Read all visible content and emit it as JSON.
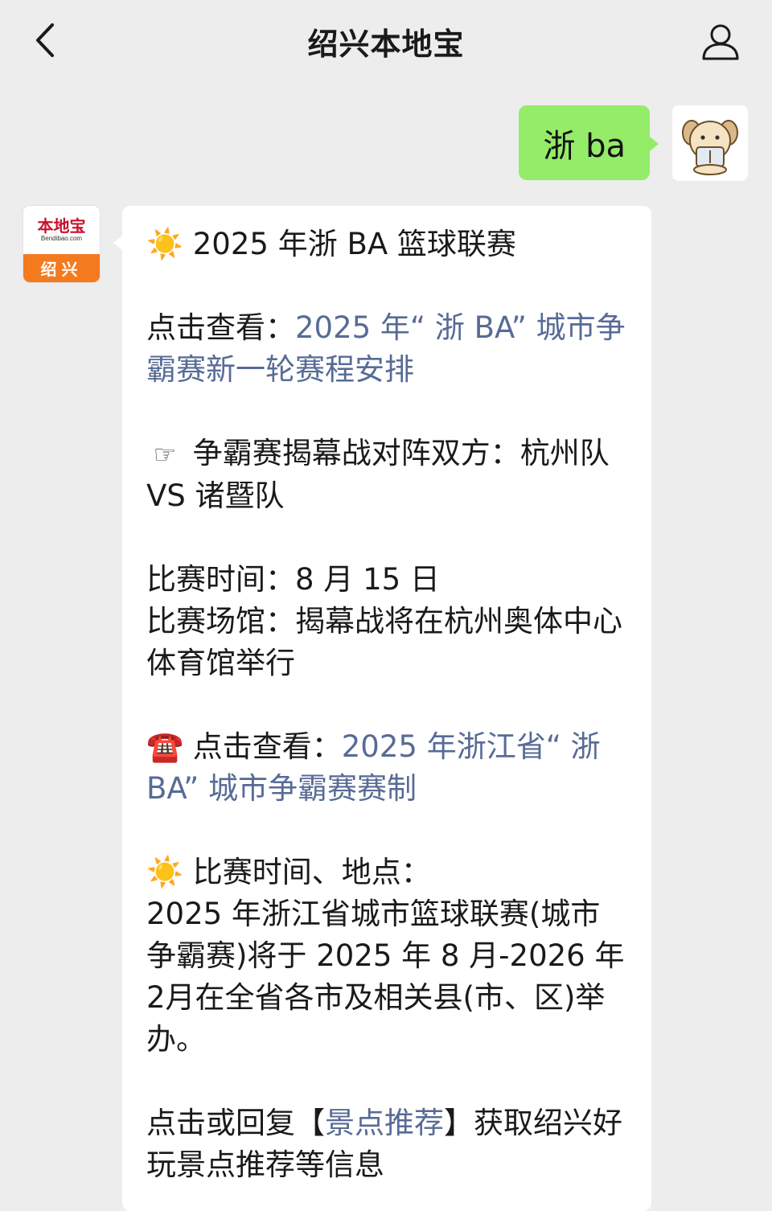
{
  "header": {
    "title": "绍兴本地宝"
  },
  "outgoing": {
    "text": "浙 ba"
  },
  "bot": {
    "logo_cn": "本地宝",
    "logo_en": "Bendibao.com",
    "logo_city": "绍兴"
  },
  "message": {
    "line1_icon": "☀️",
    "line1_text": "2025 年浙 BA 篮球联赛",
    "line2_prefix": "点击查看：",
    "line2_link": "2025 年“ 浙 BA” 城市争霸赛新一轮赛程安排",
    "line3_icon": "☞",
    "line3_text": "争霸赛揭幕战对阵双方：杭州队 VS 诸暨队",
    "line4_time": "比赛时间：8 月 15 日",
    "line4_venue": "比赛场馆：揭幕战将在杭州奥体中心体育馆举行",
    "line5_icon": "☎️",
    "line5_prefix": "点击查看：",
    "line5_link": "2025 年浙江省“ 浙 BA” 城市争霸赛赛制",
    "line6_icon": "☀️",
    "line6_heading": "比赛时间、地点：",
    "line6_body": "2025 年浙江省城市篮球联赛(城市争霸赛)将于 2025 年 8 月-2026 年 2月在全省各市及相关县(市、区)举办。",
    "line7_prefix": "点击或回复【",
    "line7_link": "景点推荐",
    "line7_suffix": "】获取绍兴好玩景点推荐等信息"
  }
}
